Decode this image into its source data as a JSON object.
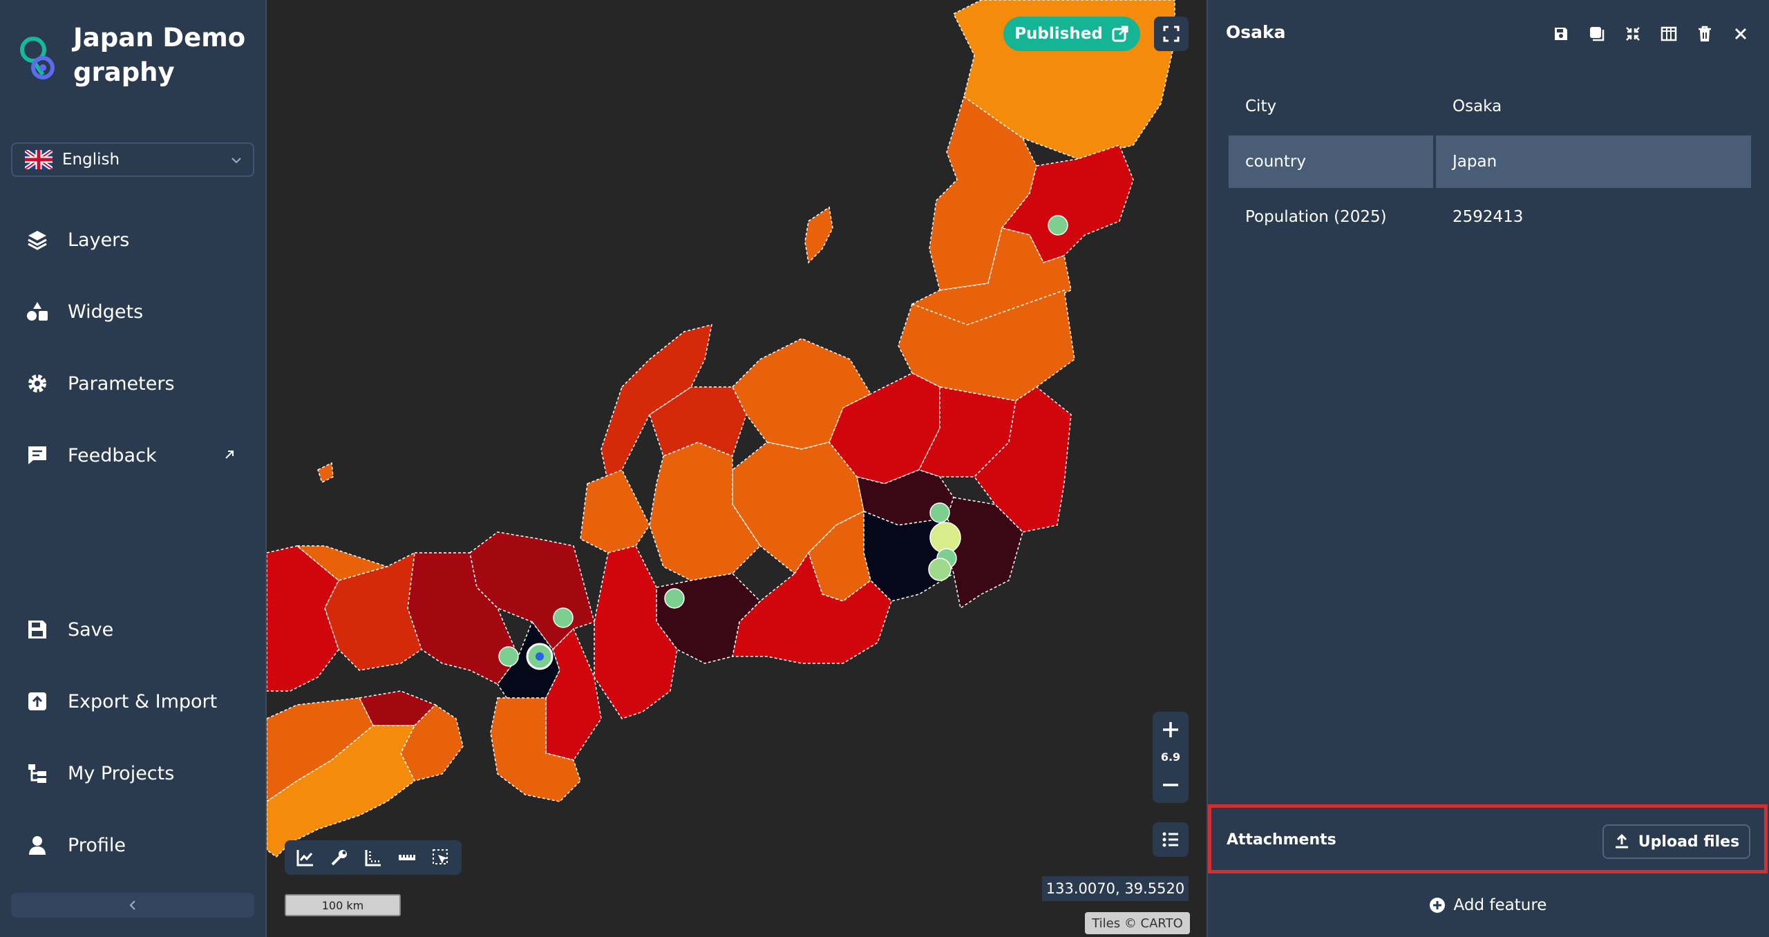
{
  "app": {
    "title": "Japan Demography"
  },
  "language": {
    "selected": "English"
  },
  "sidebar": {
    "items": [
      {
        "label": "Layers",
        "icon": "layers-icon"
      },
      {
        "label": "Widgets",
        "icon": "widgets-icon"
      },
      {
        "label": "Parameters",
        "icon": "gear-icon"
      },
      {
        "label": "Feedback",
        "icon": "feedback-icon"
      },
      {
        "label": "Save",
        "icon": "save-icon"
      },
      {
        "label": "Export & Import",
        "icon": "upload-icon"
      },
      {
        "label": "My Projects",
        "icon": "projects-icon"
      },
      {
        "label": "Profile",
        "icon": "profile-icon"
      }
    ]
  },
  "map": {
    "published_label": "Published",
    "zoom_level": "6.9",
    "scale_label": "100 km",
    "coordinates": "133.0070, 39.5520",
    "attribution": "Tiles © CARTO",
    "colors": {
      "lowest": "#f58b0a",
      "low": "#e8620c",
      "mid": "#d42a0a",
      "high": "#a3070f",
      "higher": "#3a0815",
      "highest": "#040818",
      "marker": "#7ccf8f",
      "marker_bright": "#d8ed8a"
    }
  },
  "panel": {
    "title": "Osaka",
    "attributes": [
      {
        "key": "City",
        "value": "Osaka"
      },
      {
        "key": "country",
        "value": "Japan"
      },
      {
        "key": "Population (2025)",
        "value": "2592413"
      }
    ],
    "attachments_label": "Attachments",
    "upload_label": "Upload files",
    "add_feature_label": "Add feature"
  }
}
